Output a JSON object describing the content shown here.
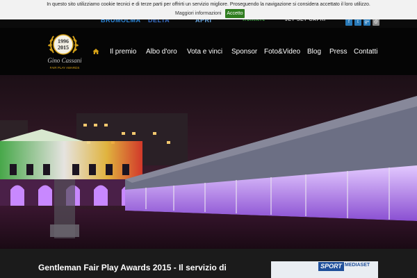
{
  "cookie": {
    "message": "In questo sito utilizziamo cookie tecnici e di terze parti per offrirti un servizio migliore. Proseguendo la navigazione si considera accettato il loro utilizzo.",
    "more_info": "Maggiori informazioni",
    "accept": "Accetto"
  },
  "sponsors": [
    "BRUMOLMA",
    "DELTA",
    "APRI",
    "frontiere",
    "JET SET CAPRI"
  ],
  "social": [
    "f",
    "t",
    "g+",
    "v",
    "@"
  ],
  "logo": {
    "year_top": "1996",
    "year_bottom": "2015",
    "signature": "Gino Cassani",
    "tagline": "FAIR PLAY AWARDS"
  },
  "nav": {
    "items": [
      "Il premio",
      "Albo d'oro",
      "Vota e vinci",
      "Sponsor",
      "Foto&Video",
      "Blog",
      "Press",
      "Contatti"
    ]
  },
  "article": {
    "title": "Gentleman Fair Play Awards 2015 - Il servizio di"
  },
  "sport_thumb": {
    "sport": "SPORT",
    "brand": "MEDIASET"
  },
  "colors": {
    "accent": "#d4a017",
    "nav_text": "#ffffff",
    "cookie_accept": "#2f7d1f",
    "header_bg": "#050505",
    "sport_blue": "#1f4f9a"
  }
}
